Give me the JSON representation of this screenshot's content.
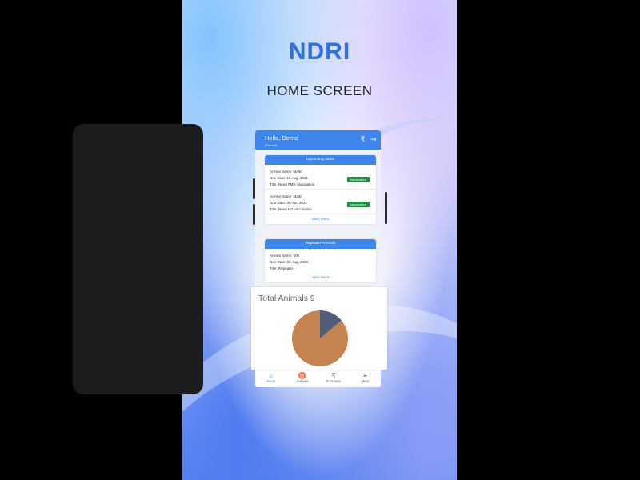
{
  "brand": "NDRI",
  "screen_title": "HOME SCREEN",
  "header": {
    "greeting": "Hello, Demo",
    "role": "(Farmer)",
    "icon_rupee": "₹",
    "icon_logout": "⇥"
  },
  "alerts_card": {
    "title": "Upcoming Alerts",
    "items": [
      {
        "animal": "Animal Name: Maitri",
        "due": "Due Date: 10 Aug, 2021",
        "title": "Title: Need FMD vaccination",
        "tag": "vaccination"
      },
      {
        "animal": "Animal Name: Maitri",
        "due": "Due Date: 06 Apr, 2022",
        "title": "Title: Need HS vaccination",
        "tag": "vaccination"
      }
    ],
    "view_more": "View More"
  },
  "repeater_card": {
    "title": "Repeater Animals",
    "items": [
      {
        "animal": "Animal Name: 500",
        "due": "Due Date: 08 Aug, 2023",
        "title": "Title: Repeater"
      }
    ],
    "view_more": "View More"
  },
  "overlay": {
    "title": "Total Animals 9",
    "colors": {
      "large": "#c4834f",
      "small": "#4f5d79"
    }
  },
  "chart_data": {
    "type": "pie",
    "title": "Total Animals 9",
    "values": [
      7.75,
      1.25
    ]
  },
  "tabs": [
    {
      "label": "Home",
      "icon": "⌂"
    },
    {
      "label": "Animals",
      "icon": "♉"
    },
    {
      "label": "Economic",
      "icon": "₹"
    },
    {
      "label": "More",
      "icon": "≡"
    }
  ]
}
